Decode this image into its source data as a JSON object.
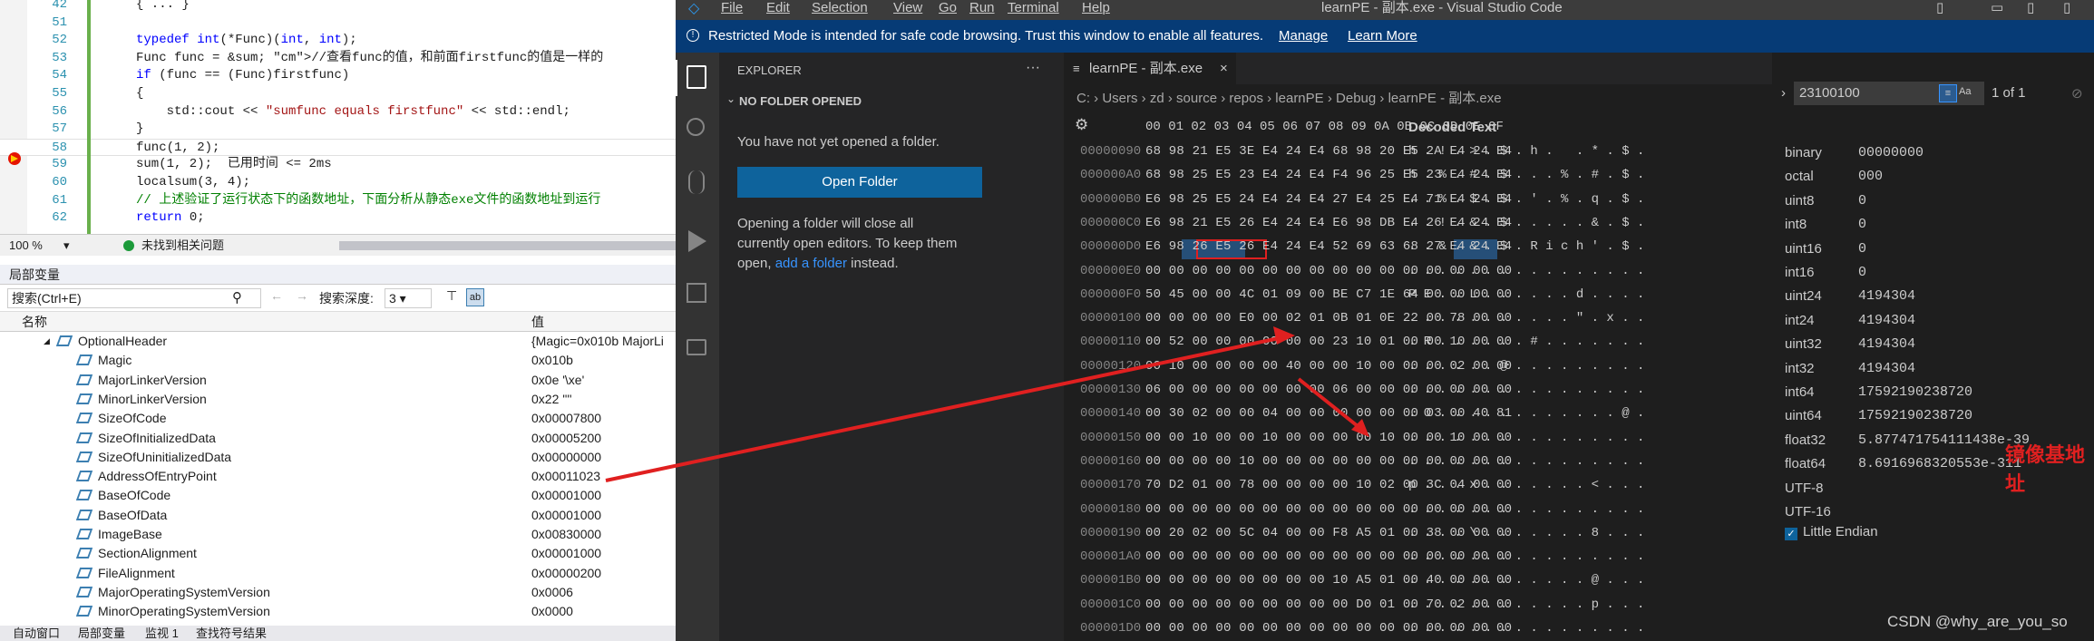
{
  "vs": {
    "code_lines": [
      {
        "no": "42",
        "text": "{ ... }",
        "cls": ""
      },
      {
        "no": "51",
        "text": "",
        "cls": ""
      },
      {
        "no": "52",
        "text": "typedef int(*Func)(int, int);",
        "cls": ""
      },
      {
        "no": "53",
        "text": "Func func = &sum; //查看func的值，和前面firstfunc的值是一样的",
        "cls": ""
      },
      {
        "no": "54",
        "text": "if (func == (Func)firstfunc)",
        "cls": ""
      },
      {
        "no": "55",
        "text": "{",
        "cls": ""
      },
      {
        "no": "56",
        "text": "    std::cout << \"sumfunc equals firstfunc\" << std::endl;",
        "cls": ""
      },
      {
        "no": "57",
        "text": "}",
        "cls": ""
      },
      {
        "no": "58",
        "text": "func(1, 2);",
        "cls": "cur"
      },
      {
        "no": "59",
        "text": "sum(1, 2);  已用时间 <= 2ms",
        "cls": ""
      },
      {
        "no": "60",
        "text": "localsum(3, 4);",
        "cls": ""
      },
      {
        "no": "61",
        "text": "// 上述验证了运行状态下的函数地址，下面分析从静态exe文件的函数地址到运行",
        "cls": "cm"
      },
      {
        "no": "62",
        "text": "return 0;",
        "cls": ""
      }
    ],
    "zoom": "100 %",
    "status_issue": "未找到相关问题",
    "locals_title": "局部变量",
    "search_placeholder": "搜索(Ctrl+E)",
    "search_depth_label": "搜索深度:",
    "search_depth_value": "3",
    "col_name": "名称",
    "col_value": "值",
    "locals": [
      {
        "name": "OptionalHeader",
        "value": "{Magic=0x010b MajorLi",
        "indent": 0
      },
      {
        "name": "Magic",
        "value": "0x010b",
        "indent": 1
      },
      {
        "name": "MajorLinkerVersion",
        "value": "0x0e '\\xe'",
        "indent": 1
      },
      {
        "name": "MinorLinkerVersion",
        "value": "0x22 '\"'",
        "indent": 1
      },
      {
        "name": "SizeOfCode",
        "value": "0x00007800",
        "indent": 1
      },
      {
        "name": "SizeOfInitializedData",
        "value": "0x00005200",
        "indent": 1
      },
      {
        "name": "SizeOfUninitializedData",
        "value": "0x00000000",
        "indent": 1
      },
      {
        "name": "AddressOfEntryPoint",
        "value": "0x00011023",
        "indent": 1
      },
      {
        "name": "BaseOfCode",
        "value": "0x00001000",
        "indent": 1
      },
      {
        "name": "BaseOfData",
        "value": "0x00001000",
        "indent": 1
      },
      {
        "name": "ImageBase",
        "value": "0x00830000",
        "indent": 1
      },
      {
        "name": "SectionAlignment",
        "value": "0x00001000",
        "indent": 1
      },
      {
        "name": "FileAlignment",
        "value": "0x00000200",
        "indent": 1
      },
      {
        "name": "MajorOperatingSystemVersion",
        "value": "0x0006",
        "indent": 1
      },
      {
        "name": "MinorOperatingSystemVersion",
        "value": "0x0000",
        "indent": 1
      }
    ],
    "bottom_tabs": [
      "自动窗口",
      "局部变量",
      "监视 1",
      "查找符号结果"
    ]
  },
  "vscode": {
    "menu": [
      "File",
      "Edit",
      "Selection",
      "View",
      "Go",
      "Run",
      "Terminal",
      "Help"
    ],
    "window_title": "learnPE - 副本.exe - Visual Studio Code",
    "banner_text": "Restricted Mode is intended for safe code browsing. Trust this window to enable all features.",
    "banner_manage": "Manage",
    "banner_learn": "Learn More",
    "explorer_title": "EXPLORER",
    "no_folder": "NO FOLDER OPENED",
    "no_folder_msg": "You have not yet opened a folder.",
    "open_folder_btn": "Open Folder",
    "close_note_1": "Opening a folder will close all",
    "close_note_2": "currently open editors. To keep them",
    "close_note_3a": "open, ",
    "close_note_link": "add a folder",
    "close_note_3b": " instead.",
    "tab_label": "learnPE - 副本.exe",
    "breadcrumb": [
      "C:",
      "Users",
      "zd",
      "source",
      "repos",
      "learnPE",
      "Debug",
      "learnPE - 副本.exe"
    ],
    "hex_header": "00 01 02 03 04 05 06 07 08 09 0A 0B 0C 0D 0E 0F",
    "decoded_header": "Decoded Text",
    "hex_rows": [
      {
        "off": "00000090",
        "bytes": "68 98 21 E5 3E E4 24 E4 68 98 20 E5 2A E4 24 E4",
        "dec": "h . ! . > . $ . h .   . * . $ ."
      },
      {
        "off": "000000A0",
        "bytes": "68 98 25 E5 23 E4 24 E4 F4 96 25 E5 23 E4 24 E4",
        "dec": "h . % . # . $ . . . % . # . $ ."
      },
      {
        "off": "000000B0",
        "bytes": "E6 98 25 E5 24 E4 24 E4 27 E4 25 E4 71 E4 24 E4",
        "dec": ". . % . $ . $ . ' . % . q . $ ."
      },
      {
        "off": "000000C0",
        "bytes": "E6 98 21 E5 26 E4 24 E4 E6 98 DB E4 26 E4 24 E4",
        "dec": ". . ! . & . $ . . . . . & . $ ."
      },
      {
        "off": "000000D0",
        "bytes": "E6 98 26 E5 26 E4 24 E4 52 69 63 68 27 E4 24 E4",
        "dec": ". . & . & . $ . R i c h ' . $ ."
      },
      {
        "off": "000000E0",
        "bytes": "00 00 00 00 00 00 00 00 00 00 00 00 00 00 00 00",
        "dec": ". . . . . . . . . . . . . . . ."
      },
      {
        "off": "000000F0",
        "bytes": "50 45 00 00 4C 01 09 00 BE C7 1E 64 00 00 00 00",
        "dec": "P E . . L . . . . . . d . . . ."
      },
      {
        "off": "00000100",
        "bytes": "00 00 00 00 E0 00 02 01 0B 01 0E 22 00 78 00 00",
        "dec": ". . . . . . . . . . . \" . x . ."
      },
      {
        "off": "00000110",
        "bytes": "00 52 00 00 00 00 00 00 23 10 01 00 00 10 00 00",
        "dec": ". R . . . . . . # . . . . . . ."
      },
      {
        "off": "00000120",
        "bytes": "00 10 00 00 00 00 40 00 00 10 00 00 00 02 00 00",
        "dec": ". . . . . . @ . . . . . . . . ."
      },
      {
        "off": "00000130",
        "bytes": "06 00 00 00 00 00 00 00 06 00 00 00 00 00 00 00",
        "dec": ". . . . . . . . . . . . . . . ."
      },
      {
        "off": "00000140",
        "bytes": "00 30 02 00 00 04 00 00 00 00 00 00 03 00 40 81",
        "dec": ". 0 . . . . . . . . . . . . @ ."
      },
      {
        "off": "00000150",
        "bytes": "00 00 10 00 00 10 00 00 00 00 10 00 00 10 00 00",
        "dec": ". . . . . . . . . . . . . . . ."
      },
      {
        "off": "00000160",
        "bytes": "00 00 00 00 10 00 00 00 00 00 00 00 00 00 00 00",
        "dec": ". . . . . . . . . . . . . . . ."
      },
      {
        "off": "00000170",
        "bytes": "70 D2 01 00 78 00 00 00 00 10 02 00 3C 04 00 00",
        "dec": "p . . . x . . . . . . . < . . ."
      },
      {
        "off": "00000180",
        "bytes": "00 00 00 00 00 00 00 00 00 00 00 00 00 00 00 00",
        "dec": ". . . . . . . . . . . . . . . ."
      },
      {
        "off": "00000190",
        "bytes": "00 20 02 00 5C 04 00 00 F8 A5 01 00 38 00 00 00",
        "dec": ". . . . \\ . . . . . . . 8 . . ."
      },
      {
        "off": "000001A0",
        "bytes": "00 00 00 00 00 00 00 00 00 00 00 00 00 00 00 00",
        "dec": ". . . . . . . . . . . . . . . ."
      },
      {
        "off": "000001B0",
        "bytes": "00 00 00 00 00 00 00 00 10 A5 01 00 40 00 00 00",
        "dec": ". . . . . . . . . . . . @ . . ."
      },
      {
        "off": "000001C0",
        "bytes": "00 00 00 00 00 00 00 00 00 D0 01 00 70 02 00 00",
        "dec": ". . . . . . . . . . . . p . . ."
      },
      {
        "off": "000001D0",
        "bytes": "00 00 00 00 00 00 00 00 00 00 00 00 00 00 00 00",
        "dec": ". . . . . . . . . . . . . . . ."
      }
    ],
    "find_value": "23100100",
    "find_result": "1 of 1",
    "inspector": [
      {
        "k": "binary",
        "v": "00000000"
      },
      {
        "k": "octal",
        "v": "000"
      },
      {
        "k": "uint8",
        "v": "0"
      },
      {
        "k": "int8",
        "v": "0"
      },
      {
        "k": "uint16",
        "v": "0"
      },
      {
        "k": "int16",
        "v": "0"
      },
      {
        "k": "uint24",
        "v": "4194304"
      },
      {
        "k": "int24",
        "v": "4194304"
      },
      {
        "k": "uint32",
        "v": "4194304"
      },
      {
        "k": "int32",
        "v": "4194304"
      },
      {
        "k": "int64",
        "v": "17592190238720"
      },
      {
        "k": "uint64",
        "v": "17592190238720"
      },
      {
        "k": "float32",
        "v": "5.877471754111438e-39"
      },
      {
        "k": "float64",
        "v": "8.6916968320553e-311"
      },
      {
        "k": "UTF-8",
        "v": ""
      },
      {
        "k": "UTF-16",
        "v": ""
      }
    ],
    "little_endian": "Little Endian",
    "annotation": "镜像基地址",
    "watermark": "CSDN @why_are_you_so",
    "colors": {
      "activity": "#333333",
      "sidebar": "#252526",
      "editor": "#1e1e1e",
      "banner": "#063b76",
      "button": "#0e639c",
      "arrow": "#e02020"
    }
  }
}
